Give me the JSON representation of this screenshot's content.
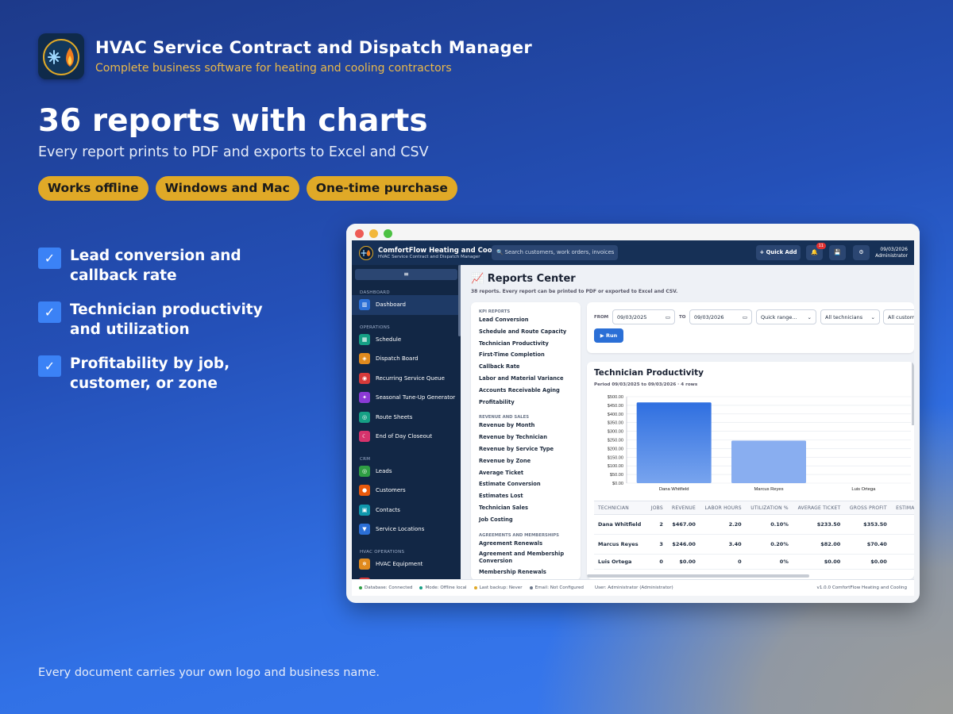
{
  "brand": {
    "title": "HVAC Service Contract and Dispatch Manager",
    "subtitle": "Complete business software for heating and cooling contractors"
  },
  "hero": {
    "title": "36 reports with charts",
    "subtitle": "Every report prints to PDF and exports to Excel and CSV"
  },
  "pills": [
    "Works offline",
    "Windows and Mac",
    "One-time purchase"
  ],
  "features": [
    {
      "check": "✓",
      "line1": "Lead conversion and",
      "line2": "callback rate"
    },
    {
      "check": "✓",
      "line1": "Technician productivity",
      "line2": "and utilization"
    },
    {
      "check": "✓",
      "line1": "Profitability by job,",
      "line2": "customer, or zone"
    }
  ],
  "footer": "Every document carries your own logo and business name.",
  "app": {
    "name": "ComfortFlow Heating and Cooling",
    "tagline": "HVAC Service Contract and Dispatch Manager",
    "search_placeholder": "Search customers, work orders, invoices",
    "quick_add": "+ Quick Add",
    "notif_count": "11",
    "date": "09/03/2026",
    "user": "Administrator",
    "collapse_icon": "≡",
    "sidebar": [
      {
        "section": "DASHBOARD",
        "items": [
          {
            "label": "Dashboard",
            "icon": "chart-icon",
            "color": "#2b6fd6",
            "glyph": "▥",
            "active": true
          }
        ]
      },
      {
        "section": "OPERATIONS",
        "items": [
          {
            "label": "Schedule",
            "icon": "calendar-icon",
            "color": "#16a085",
            "glyph": "▦"
          },
          {
            "label": "Dispatch Board",
            "icon": "map-icon",
            "color": "#e08a1e",
            "glyph": "◈"
          },
          {
            "label": "Recurring Service Queue",
            "icon": "bell-icon",
            "color": "#d63a3a",
            "glyph": "◉"
          },
          {
            "label": "Seasonal Tune-Up Generator",
            "icon": "tools-icon",
            "color": "#8a3ad6",
            "glyph": "✦"
          },
          {
            "label": "Route Sheets",
            "icon": "compass-icon",
            "color": "#16a085",
            "glyph": "◎"
          },
          {
            "label": "End of Day Closeout",
            "icon": "moon-icon",
            "color": "#d6336c",
            "glyph": "☾"
          }
        ]
      },
      {
        "section": "CRM",
        "items": [
          {
            "label": "Leads",
            "icon": "target-icon",
            "color": "#2f9e44",
            "glyph": "◎"
          },
          {
            "label": "Customers",
            "icon": "users-icon",
            "color": "#e8590c",
            "glyph": "●"
          },
          {
            "label": "Contacts",
            "icon": "contacts-icon",
            "color": "#1098ad",
            "glyph": "▣"
          },
          {
            "label": "Service Locations",
            "icon": "pin-icon",
            "color": "#2b6fd6",
            "glyph": "▼"
          }
        ]
      },
      {
        "section": "HVAC OPERATIONS",
        "items": [
          {
            "label": "HVAC Equipment",
            "icon": "snowflake-icon",
            "color": "#e08a1e",
            "glyph": "❄"
          },
          {
            "label": "Service Calls",
            "icon": "phone-icon",
            "color": "#d63a3a",
            "glyph": "✆"
          }
        ]
      }
    ],
    "status": [
      {
        "label": "Database: Connected",
        "color": "#2f9e44"
      },
      {
        "label": "Mode: Offline local",
        "color": "#16a085"
      },
      {
        "label": "Last backup: Never",
        "color": "#e0a927"
      },
      {
        "label": "Email: Not Configured",
        "color": "#6b7689"
      },
      {
        "label": "User: Administrator (Administrator)",
        "color": ""
      }
    ],
    "version": "v1.0.0 ComfortFlow Heating and Cooling",
    "reports": {
      "title": "📈 Reports Center",
      "subtitle": "38 reports. Every report can be printed to PDF or exported to Excel and CSV.",
      "list": [
        {
          "section": "KPI REPORTS",
          "items": [
            "Lead Conversion",
            "Schedule and Route Capacity",
            "Technician Productivity",
            "First-Time Completion",
            "Callback Rate",
            "Labor and Material Variance",
            "Accounts Receivable Aging",
            "Profitability"
          ]
        },
        {
          "section": "REVENUE AND SALES",
          "items": [
            "Revenue by Month",
            "Revenue by Technician",
            "Revenue by Service Type",
            "Revenue by Zone",
            "Average Ticket",
            "Estimate Conversion",
            "Estimates Lost",
            "Technician Sales",
            "Job Costing"
          ]
        },
        {
          "section": "AGREEMENTS AND MEMBERSHIPS",
          "items": [
            "Agreement Renewals",
            "Agreement and Membership Conversion",
            "Membership Renewals"
          ]
        }
      ],
      "filters": {
        "from_label": "FROM",
        "from": "09/03/2025",
        "to_label": "TO",
        "to": "09/03/2026",
        "quick": "Quick range...",
        "tech": "All technicians",
        "cust": "All customers",
        "run": "▶ Run"
      },
      "chart_title": "Technician Productivity",
      "chart_sub": "Period 09/03/2025 to 09/03/2026 · 4 rows",
      "table": {
        "headers": [
          "TECHNICIAN",
          "JOBS",
          "REVENUE",
          "LABOR HOURS",
          "UTILIZATION %",
          "AVERAGE TICKET",
          "GROSS PROFIT",
          "ESTIMATES"
        ],
        "rows": [
          [
            "Dana Whitfield",
            "2",
            "$467.00",
            "2.20",
            "0.10%",
            "$233.50",
            "$353.50"
          ],
          [
            "Marcus Reyes",
            "3",
            "$246.00",
            "3.40",
            "0.20%",
            "$82.00",
            "$70.40"
          ],
          [
            "Luis Ortega",
            "0",
            "$0.00",
            "0",
            "0%",
            "$0.00",
            "$0.00"
          ]
        ]
      }
    }
  },
  "chart_data": {
    "type": "bar",
    "title": "Technician Productivity",
    "categories": [
      "Dana Whitfield",
      "Marcus Reyes",
      "Luis Ortega"
    ],
    "values": [
      467,
      246,
      0
    ],
    "yticks": [
      "$0.00",
      "$50.00",
      "$100.00",
      "$150.00",
      "$200.00",
      "$250.00",
      "$300.00",
      "$350.00",
      "$400.00",
      "$450.00",
      "$500.00"
    ],
    "ylim": [
      0,
      500
    ],
    "grid": true,
    "bar_colors": [
      "#3f7fe3",
      "#89aef0",
      "#89aef0"
    ]
  }
}
